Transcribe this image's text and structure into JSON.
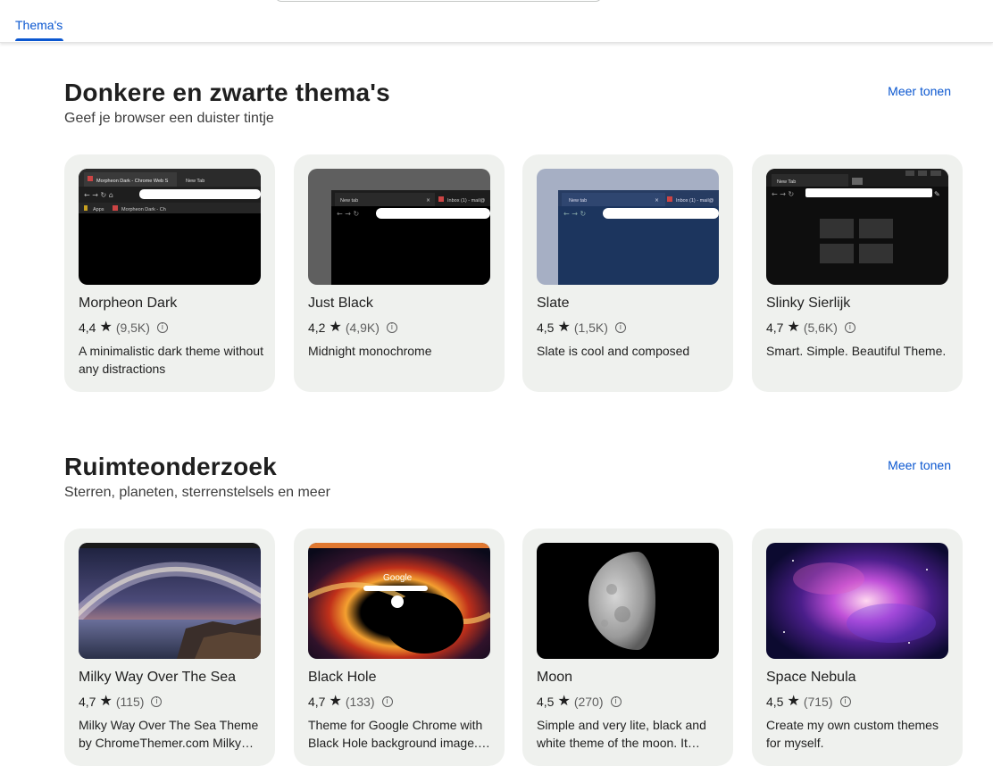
{
  "topbar": {
    "tab_label": "Thema's"
  },
  "sections": [
    {
      "title": "Donkere en zwarte thema's",
      "subtitle": "Geef je browser een duister tintje",
      "more": "Meer tonen",
      "cards": [
        {
          "name": "Morpheon Dark",
          "rating": "4,4",
          "count": "(9,5K)",
          "desc": "A minimalistic dark theme without any distractions",
          "tab1": "Morpheon Dark - Chrome Web S",
          "tab2": "New Tab",
          "bm1": "Apps",
          "bm2": "Morpheon Dark - Ch"
        },
        {
          "name": "Just Black",
          "rating": "4,2",
          "count": "(4,9K)",
          "desc": "Midnight monochrome",
          "tab1": "New tab",
          "tab2": "Inbox (1) - mail@"
        },
        {
          "name": "Slate",
          "rating": "4,5",
          "count": "(1,5K)",
          "desc": "Slate is cool and composed",
          "tab1": "New tab",
          "tab2": "Inbox (1) - mail@"
        },
        {
          "name": "Slinky Sierlijk",
          "rating": "4,7",
          "count": "(5,6K)",
          "desc": "Smart. Simple. Beautiful Theme.",
          "tab1": "New Tab"
        }
      ]
    },
    {
      "title": "Ruimteonderzoek",
      "subtitle": "Sterren, planeten, sterrenstelsels en meer",
      "more": "Meer tonen",
      "cards": [
        {
          "name": "Milky Way Over The Sea",
          "rating": "4,7",
          "count": "(115)",
          "desc": "Milky Way Over The Sea Theme by ChromeThemer.com Milky…"
        },
        {
          "name": "Black Hole",
          "rating": "4,7",
          "count": "(133)",
          "desc": "Theme for Google Chrome with Black Hole background image.…",
          "logo": "Google"
        },
        {
          "name": "Moon",
          "rating": "4,5",
          "count": "(270)",
          "desc": "Simple and very lite, black and white theme of the moon. It…"
        },
        {
          "name": "Space Nebula",
          "rating": "4,5",
          "count": "(715)",
          "desc": "Create my own custom themes for myself."
        }
      ]
    }
  ],
  "icons": {
    "star": "star-icon",
    "info": "info-icon"
  },
  "colors": {
    "accent": "#0b57d0",
    "card_bg": "#eff1ee"
  }
}
